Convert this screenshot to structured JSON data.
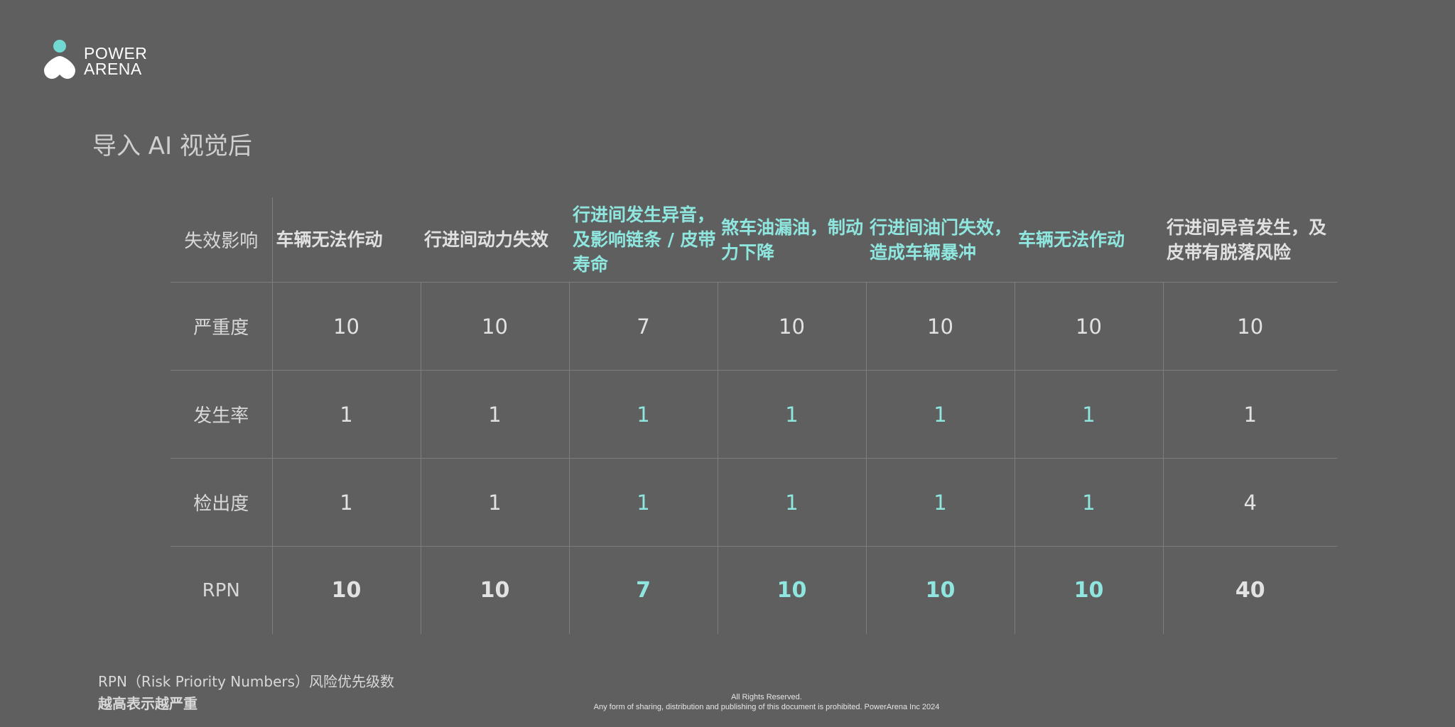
{
  "brand": {
    "logo_text_line1": "POWER",
    "logo_text_line2": "ARENA",
    "accent_color": "#8ee6df"
  },
  "page": {
    "title": "导入 AI 视觉后"
  },
  "table": {
    "corner_label": "失效影响",
    "columns": [
      {
        "header": "车辆无法作动",
        "highlight": false
      },
      {
        "header": "行进间动力失效",
        "highlight": false
      },
      {
        "header": "行进间发生异音，及影响链条 / 皮带寿命",
        "highlight": true
      },
      {
        "header": "煞车油漏油，制动力下降",
        "highlight": true
      },
      {
        "header": "行进间油门失效，造成车辆暴冲",
        "highlight": true
      },
      {
        "header": "车辆无法作动",
        "highlight": true
      },
      {
        "header": "行进间异音发生，及皮带有脱落风险",
        "highlight": false
      }
    ],
    "rows": [
      {
        "label": "严重度",
        "values": [
          "10",
          "10",
          "7",
          "10",
          "10",
          "10",
          "10"
        ],
        "highlight": [
          false,
          false,
          false,
          false,
          false,
          false,
          false
        ]
      },
      {
        "label": "发生率",
        "values": [
          "1",
          "1",
          "1",
          "1",
          "1",
          "1",
          "1"
        ],
        "highlight": [
          false,
          false,
          true,
          true,
          true,
          true,
          false
        ]
      },
      {
        "label": "检出度",
        "values": [
          "1",
          "1",
          "1",
          "1",
          "1",
          "1",
          "4"
        ],
        "highlight": [
          false,
          false,
          true,
          true,
          true,
          true,
          false
        ]
      },
      {
        "label": "RPN",
        "values": [
          "10",
          "10",
          "7",
          "10",
          "10",
          "10",
          "40"
        ],
        "highlight": [
          false,
          false,
          true,
          true,
          true,
          true,
          false
        ]
      }
    ]
  },
  "footnote": {
    "line1": "RPN（Risk Priority Numbers）风险优先级数",
    "line2": "越高表示越严重"
  },
  "footer": {
    "line1": "All Rights Reserved.",
    "line2": "Any form of sharing, distribution and publishing of this document is prohibited. PowerArena Inc 2024"
  }
}
